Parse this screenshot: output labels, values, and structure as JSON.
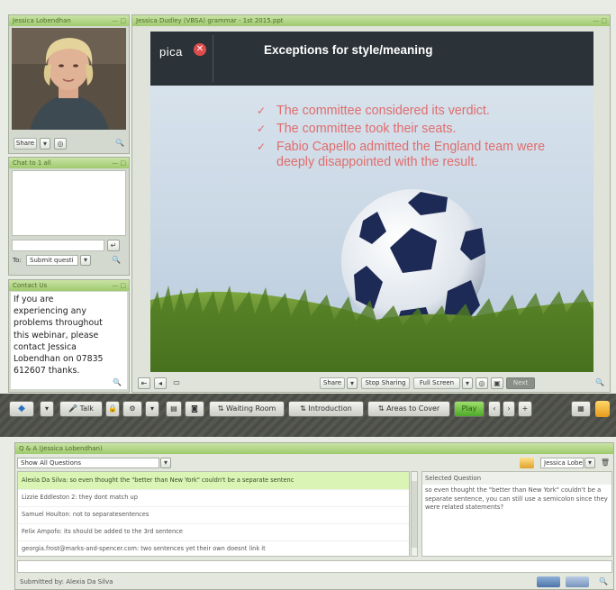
{
  "webcam": {
    "title": "Jessica Lobendhan",
    "share": "Share",
    "avatar": "person-photo"
  },
  "chat": {
    "title": "Chat to 1 all",
    "to_label": "To:",
    "to_value": "Submit questi"
  },
  "contact": {
    "title": "Contact Us",
    "text": "If you are experiencing any problems throughout this webinar, please contact Jessica Lobendhan on 07835 612607 thanks."
  },
  "presentation": {
    "title": "Jessica Dudley (VBSA) grammar - 1st 2015.ppt",
    "logo": "pica",
    "slide_title": "Exceptions for style/meaning",
    "bullets": [
      "The committee considered its verdict.",
      "The committee took their seats.",
      "Fabio Capello admitted the England team were deeply disappointed  with the result."
    ],
    "share": "Share",
    "stop_sharing": "Stop Sharing",
    "full_screen": "Full Screen",
    "next": "Next"
  },
  "toolbar": {
    "talk": "Talk",
    "tabs": [
      "Waiting Room",
      "Introduction",
      "Areas to Cover"
    ],
    "play": "Play"
  },
  "qa": {
    "title": "Q & A (Jessica Lobendhan)",
    "filter": "Show All Questions",
    "assignee": "Jessica Lobenc",
    "questions": [
      "Alexia Da Silva: so even thought the \"better than New York\" couldn't be a separate sentenc",
      "Lizzie Eddleston 2: they dont match up",
      "Samuel Houlton: not to separatesentences",
      "Felix Ampofo: its should be added to the 3rd sentence",
      "georgia.frost@marks-and-spencer.com: two sentences yet their own doesnt link it"
    ],
    "selected_label": "Selected Question",
    "selected_text": "so even thought the \"better than New York\" couldn't be a separate sentence, you can still use a semicolon since they were related statements?",
    "submitted_by": "Submitted by: Alexia Da Silva"
  },
  "colors": {
    "panel_green": "#9fca6e",
    "accent": "#e26b6b",
    "chat_highlight": "#d9f4b4"
  }
}
